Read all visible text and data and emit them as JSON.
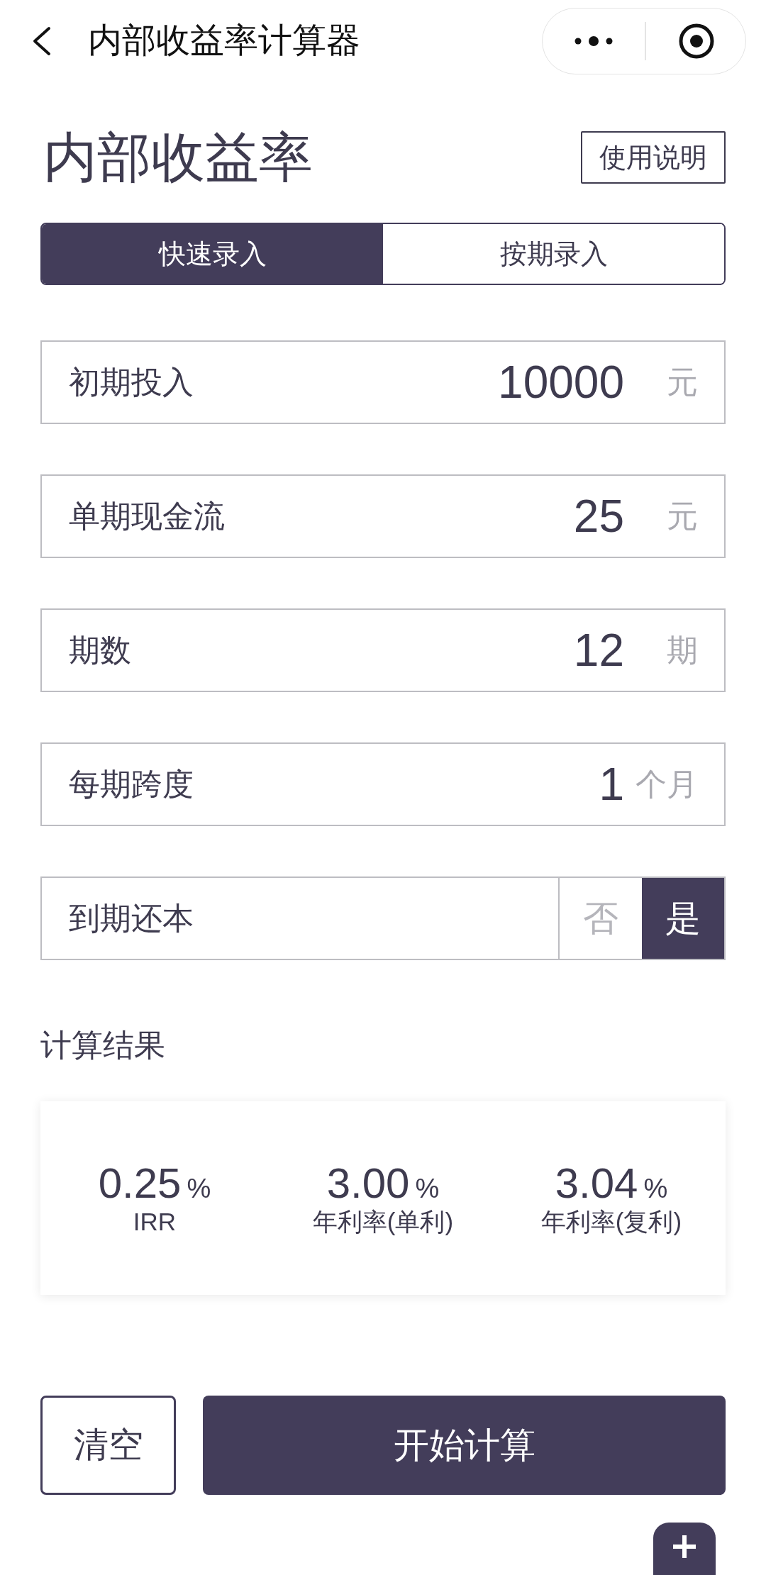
{
  "nav_bar": {
    "title": "内部收益率计算器"
  },
  "header": {
    "title": "内部收益率",
    "help_button": "使用说明"
  },
  "tabs": [
    {
      "label": "快速录入",
      "selected": true
    },
    {
      "label": "按期录入",
      "selected": false
    }
  ],
  "fields": [
    {
      "kind": "input",
      "label": "初期投入",
      "value": "10000",
      "unit": "元"
    },
    {
      "kind": "input",
      "label": "单期现金流",
      "value": "25",
      "unit": "元"
    },
    {
      "kind": "input",
      "label": "期数",
      "value": "12",
      "unit": "期"
    },
    {
      "kind": "input",
      "label": "每期跨度",
      "value": "1",
      "unit": "个月"
    },
    {
      "kind": "toggle",
      "label": "到期还本",
      "options": [
        {
          "label": "否",
          "selected": false
        },
        {
          "label": "是",
          "selected": true
        }
      ]
    }
  ],
  "results": {
    "title": "计算结果",
    "items": [
      {
        "value": "0.25",
        "unit": "%",
        "label": "IRR"
      },
      {
        "value": "3.00",
        "unit": "%",
        "label": "年利率(单利)"
      },
      {
        "value": "3.04",
        "unit": "%",
        "label": "年利率(复利)"
      }
    ]
  },
  "buttons": [
    {
      "kind": "outline",
      "label": "清空"
    },
    {
      "kind": "filled",
      "label": "开始计算"
    }
  ]
}
